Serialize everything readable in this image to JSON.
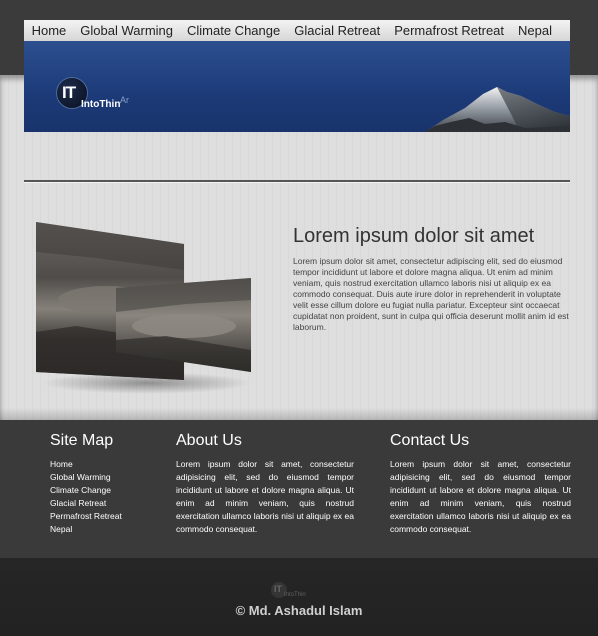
{
  "nav": {
    "items": [
      {
        "label": "Home"
      },
      {
        "label": "Global Warming"
      },
      {
        "label": "Climate Change"
      },
      {
        "label": "Glacial Retreat"
      },
      {
        "label": "Permafrost Retreat"
      },
      {
        "label": "Nepal"
      }
    ]
  },
  "logo": {
    "mark": "IT",
    "text": "IntoThin",
    "suffix": "Ar"
  },
  "article": {
    "title": "Lorem ipsum dolor sit amet",
    "body": "Lorem ipsum dolor sit amet, consectetur adipiscing elit, sed do eiusmod tempor incididunt ut labore et dolore magna aliqua. Ut enim ad minim veniam, quis nostrud exercitation ullamco laboris nisi ut aliquip ex ea commodo consequat. Duis aute irure dolor in reprehenderit in voluptate velit esse cillum dolore eu fugiat nulla pariatur. Excepteur sint occaecat cupidatat non proident, sunt in culpa qui officia deserunt mollit anim id est laborum."
  },
  "footer": {
    "sitemap": {
      "title": "Site Map",
      "links": [
        "Home",
        "Global Warming",
        "Climate Change",
        "Glacial Retreat",
        "Permafrost Retreat",
        "Nepal"
      ]
    },
    "about": {
      "title": "About Us",
      "body": "Lorem ipsum dolor sit amet, consectetur adipisicing elit, sed do eiusmod tempor incididunt ut labore et dolore magna aliqua. Ut enim ad minim veniam, quis nostrud exercitation ullamco laboris nisi ut aliquip ex ea commodo consequat."
    },
    "contact": {
      "title": "Contact Us",
      "body": "Lorem ipsum dolor sit amet, consectetur adipisicing elit, sed do eiusmod tempor incididunt ut labore et dolore magna aliqua. Ut enim ad minim veniam, quis nostrud exercitation ullamco laboris nisi ut aliquip ex ea commodo consequat."
    },
    "logo_mark": "IT",
    "logo_text": "IntoThin",
    "copyright": "© Md. Ashadul Islam"
  },
  "colors": {
    "banner_blue": "#1c3a78",
    "footer_dark": "#3a3a3a",
    "bottom_dark": "#222222",
    "page_light": "#dedede"
  },
  "icons": {
    "logo": "site-logo-icon",
    "photo": "glacial-lake-photo"
  }
}
